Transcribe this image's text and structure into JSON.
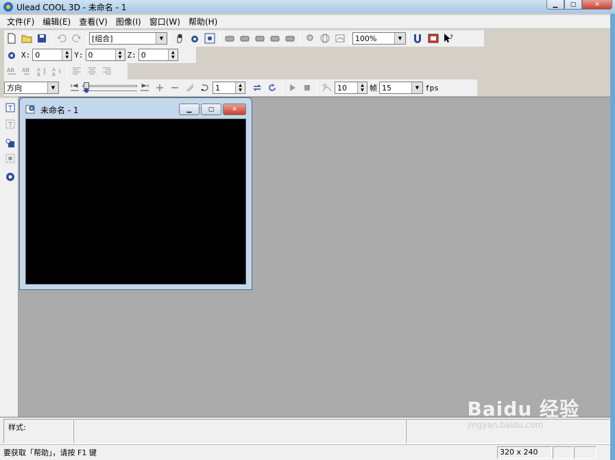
{
  "window": {
    "title": "Ulead COOL 3D - 未命名 - 1"
  },
  "menu": [
    "文件(F)",
    "编辑(E)",
    "查看(V)",
    "图像(I)",
    "窗口(W)",
    "帮助(H)"
  ],
  "toolbar": {
    "object_select": "[组合]",
    "zoom": "100%"
  },
  "position": {
    "x_label": "X:",
    "x_value": "0",
    "y_label": "Y:",
    "y_value": "0",
    "z_label": "Z:",
    "z_value": "0"
  },
  "animation": {
    "property": "方向",
    "frame": "1",
    "frame_count": "10",
    "frame_unit": "帧",
    "fps_value": "15",
    "fps_label": "fps"
  },
  "document": {
    "title": "未命名 - 1"
  },
  "properties": {
    "style_label": "样式:"
  },
  "status": {
    "message": "要获取「帮助」，请按 F1 键",
    "dimensions": "320 x 240"
  },
  "watermark": {
    "brand": "Baidu 经验",
    "sub": "jingyan.baidu.com"
  },
  "colors": {
    "workspace": "#ababab",
    "canvas": "#000000",
    "chrome": "#f0f0f0"
  }
}
